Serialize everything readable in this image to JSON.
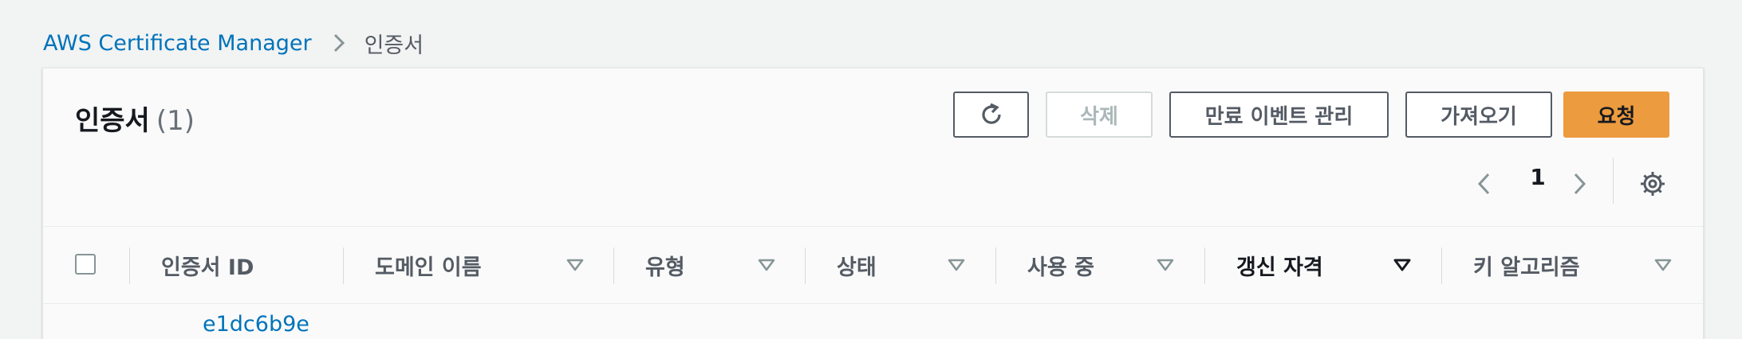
{
  "breadcrumb": {
    "root": "AWS Certificate Manager",
    "current": "인증서"
  },
  "header": {
    "title": "인증서",
    "count": "(1)"
  },
  "toolbar": {
    "refresh_icon": "refresh-icon",
    "delete_label": "삭제",
    "manage_expiry_label": "만료 이벤트 관리",
    "import_label": "가져오기",
    "request_label": "요청"
  },
  "pagination": {
    "current_page": "1"
  },
  "table": {
    "columns": [
      {
        "label": "인증서 ID",
        "sortable": false
      },
      {
        "label": "도메인 이름",
        "sortable": true
      },
      {
        "label": "유형",
        "sortable": true
      },
      {
        "label": "상태",
        "sortable": true
      },
      {
        "label": "사용 중",
        "sortable": true
      },
      {
        "label": "갱신 자격",
        "sortable": true,
        "sorted": true
      },
      {
        "label": "키 알고리즘",
        "sortable": true
      }
    ],
    "rows": [
      {
        "certificate_id": "e1dc6b9e"
      }
    ]
  },
  "colors": {
    "link": "#0073bb",
    "primary": "#ec9b3e",
    "disabled": "#aab7b8"
  }
}
